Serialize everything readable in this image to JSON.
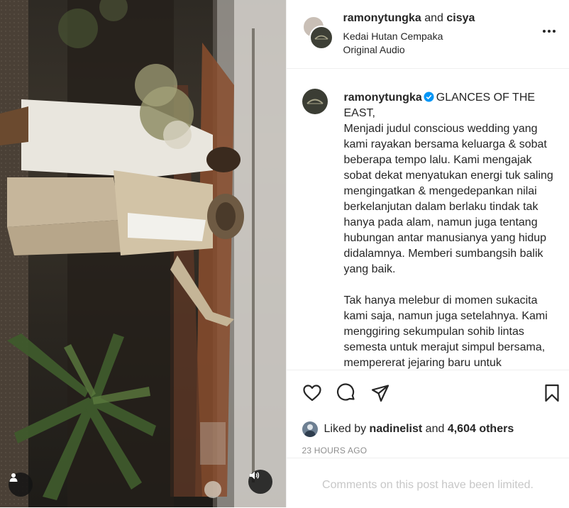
{
  "header": {
    "user1": "ramonytungka",
    "connector": " and ",
    "user2": "cisya",
    "location": "Kedai Hutan Cempaka",
    "audio": "Original Audio",
    "more_icon": "more-horizontal-icon"
  },
  "caption": {
    "username": "ramonytungka",
    "verified_icon": "verified-badge-icon",
    "paragraph1": "GLANCES OF THE EAST,\nMenjadi judul conscious wedding yang kami rayakan bersama keluarga & sobat beberapa tempo lalu. Kami mengajak sobat dekat menyatukan energi tuk saling mengingatkan & mengedepankan nilai berkelanjutan dalam berlaku tindak tak hanya pada alam, namun juga tentang hubungan antar manusianya yang hidup didalamnya. Memberi sumbangsih balik yang baik.",
    "paragraph2": "Tak hanya melebur di momen sukacita kami saja, namun juga setelahnya. Kami menggiring sekumpulan sohib lintas semesta untuk merajut simpul bersama, mempererat jejaring baru untuk"
  },
  "actions": {
    "like_icon": "heart-icon",
    "comment_icon": "comment-icon",
    "share_icon": "paper-plane-icon",
    "save_icon": "bookmark-icon"
  },
  "likes": {
    "prefix": "Liked by ",
    "user": "nadinelist",
    "middle": " and ",
    "count": "4,604 others"
  },
  "timestamp": "23 HOURS AGO",
  "comments_limited": "Comments on this post have been limited.",
  "media": {
    "tag_icon": "user-tag-icon",
    "audio_icon": "speaker-icon"
  },
  "colors": {
    "text": "#262626",
    "muted": "#8e8e8e",
    "border": "#efefef",
    "verified": "#0095f6"
  }
}
